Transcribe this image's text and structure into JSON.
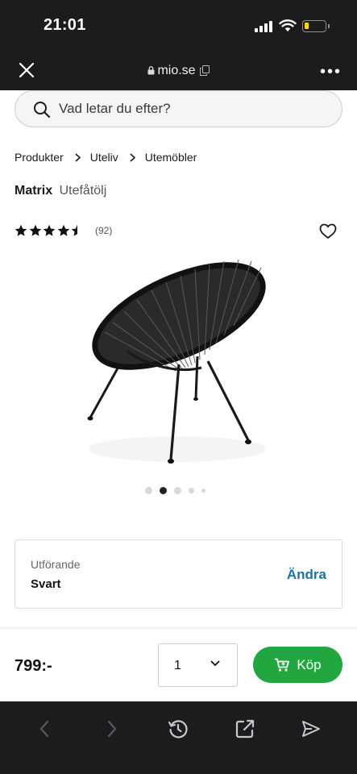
{
  "status_bar": {
    "time": "21:01"
  },
  "browser": {
    "url": "mio.se"
  },
  "search": {
    "placeholder": "Vad letar du efter?"
  },
  "breadcrumb": [
    "Produkter",
    "Uteliv",
    "Utemöbler"
  ],
  "product": {
    "brand": "Matrix",
    "name": "Utefåtölj",
    "rating": 4.5,
    "max_rating": 5,
    "review_count": "(92)",
    "image_count": 5,
    "current_image": 2
  },
  "variant": {
    "label": "Utförande",
    "value": "Svart",
    "change_label": "Ändra"
  },
  "purchase": {
    "price": "799:-",
    "quantity": "1",
    "buy_label": "Köp"
  },
  "colors": {
    "buy_green": "#22a640",
    "link_blue": "#1a73a8",
    "bar_dark": "#1c1c1e"
  },
  "toolbar_icons": [
    "back-arrow-icon",
    "forward-arrow-icon",
    "history-icon",
    "share-icon",
    "send-icon"
  ]
}
